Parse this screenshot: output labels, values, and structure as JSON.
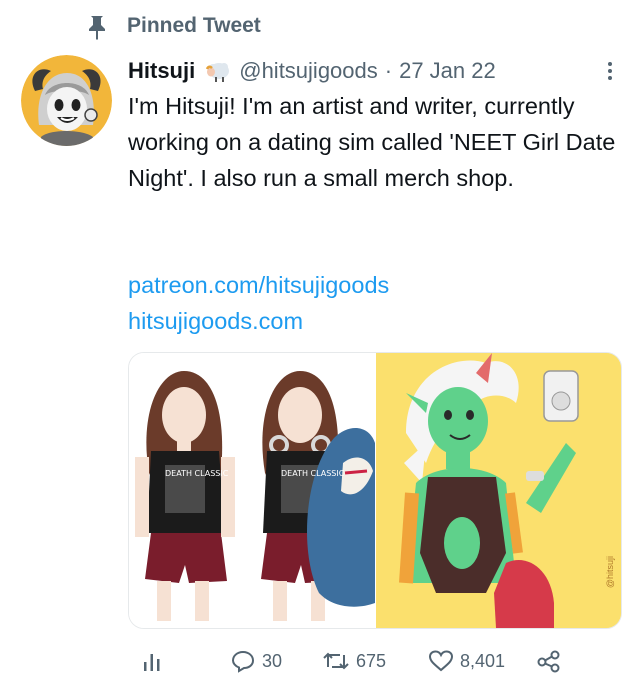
{
  "pinned": {
    "label": "Pinned Tweet"
  },
  "tweet": {
    "author_name": "Hitsuji",
    "handle": "@hitsujigoods",
    "separator": "·",
    "date": "27 Jan 22",
    "text": "I'm Hitsuji! I'm an artist and writer, currently working on a dating sim called 'NEET Girl Date Night'. I also run a small merch shop.",
    "links": [
      "patreon.com/hitsujigoods",
      "hitsujigoods.com"
    ]
  },
  "media": {
    "left_shirt_text": "DEATH CLASSIC",
    "right_watermark": "@hitsuji"
  },
  "actions": {
    "replies": "30",
    "retweets": "675",
    "likes": "8,401"
  },
  "icons": [
    "pin-icon",
    "sheep-emoji-icon",
    "more-icon",
    "analytics-icon",
    "reply-icon",
    "retweet-icon",
    "like-icon",
    "share-icon"
  ],
  "colors": {
    "link": "#1d9bf0",
    "muted": "#536471",
    "text": "#0f1419",
    "art_bg": "#fbe06d"
  }
}
